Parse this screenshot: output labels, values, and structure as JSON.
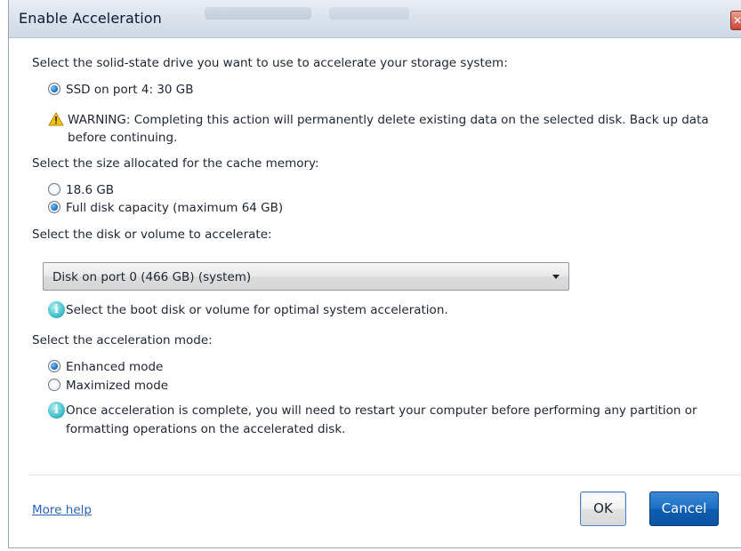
{
  "window": {
    "title": "Enable Acceleration",
    "close_glyph": "✕"
  },
  "ssd_section": {
    "prompt": "Select the solid-state drive you want to use to accelerate your storage system:",
    "option": "SSD on port 4: 30 GB",
    "warning_line1": "WARNING: Completing this action will permanently delete existing data on the selected disk. Back up data",
    "warning_line2": "before continuing."
  },
  "cache_section": {
    "prompt": "Select the size allocated for the cache memory:",
    "options": [
      "18.6 GB",
      "Full disk capacity (maximum 64 GB)"
    ],
    "selected_index": 1
  },
  "volume_section": {
    "prompt": "Select the disk or volume to accelerate:",
    "selected_value": "Disk on port 0 (466 GB) (system)",
    "info": "Select the boot disk or volume for optimal system acceleration."
  },
  "mode_section": {
    "prompt": "Select the acceleration mode:",
    "options": [
      "Enhanced mode",
      "Maximized mode"
    ],
    "selected_index": 0,
    "info_line1": "Once acceleration is complete, you will need to restart your computer before performing any partition or",
    "info_line2": "formatting operations on the accelerated disk."
  },
  "footer": {
    "more_help": "More help",
    "ok": "OK",
    "cancel": "Cancel"
  },
  "icons": {
    "warning": "warning-triangle-icon",
    "info": "info-icon"
  },
  "colors": {
    "accent": "#1b6ec4",
    "link": "#2a63b6",
    "warning": "#f2c21b"
  }
}
